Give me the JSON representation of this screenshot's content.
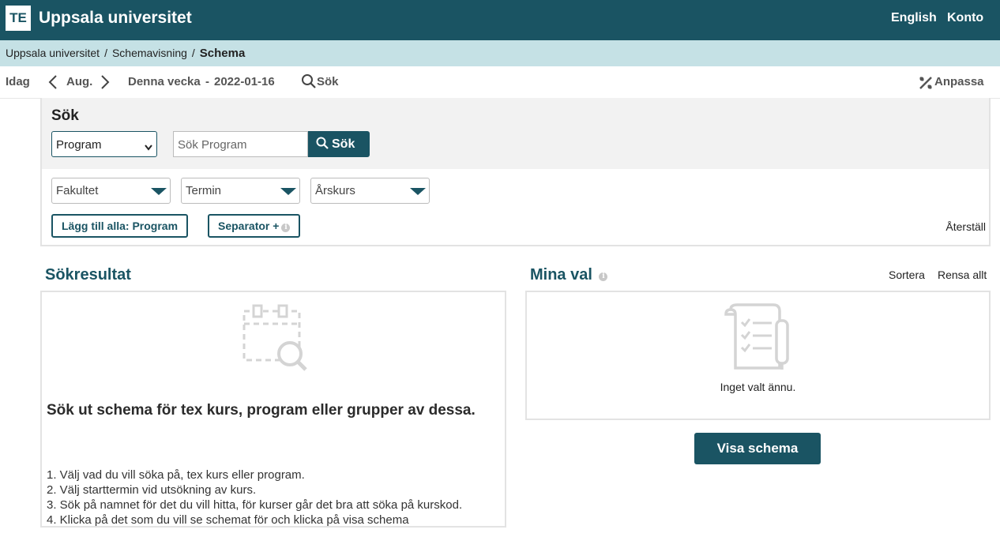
{
  "header": {
    "logo": "TE",
    "title": "Uppsala universitet",
    "links": [
      "English",
      "Konto"
    ]
  },
  "breadcrumb": {
    "items": [
      "Uppsala universitet",
      "Schemavisning"
    ],
    "current": "Schema"
  },
  "toolbar": {
    "today": "Idag",
    "view": "Aug.",
    "week_label": "Denna vecka",
    "date": "2022-01-16",
    "search": "Sök",
    "customize": "Anpassa"
  },
  "search_panel": {
    "title": "Sök",
    "type_select": "Program",
    "search_placeholder": "Sök Program",
    "search_button": "Sök",
    "filters": [
      "Fakultet",
      "Termin",
      "Årskurs"
    ],
    "add_all_button": "Lägg till alla: Program",
    "separator_button": "Separator +",
    "reset": "Återställ"
  },
  "results": {
    "title": "Sökresultat",
    "heading": "Sök ut schema för tex kurs, program eller grupper av dessa.",
    "steps": [
      "1. Välj vad du vill söka på, tex kurs eller program.",
      "2. Välj starttermin vid utsökning av kurs.",
      "3. Sök på namnet för det du vill hitta, för kurser går det bra att söka på kurskod.",
      "4. Klicka på det som du vill se schemat för och klicka på visa schema"
    ]
  },
  "choices": {
    "title": "Mina val",
    "sort": "Sortera",
    "clear": "Rensa allt",
    "empty": "Inget valt ännu.",
    "show_button": "Visa schema"
  },
  "colors": {
    "brand": "#1a5463",
    "breadcrumb_bg": "#c5e1e5",
    "panel_bg": "#f2f2f2"
  }
}
